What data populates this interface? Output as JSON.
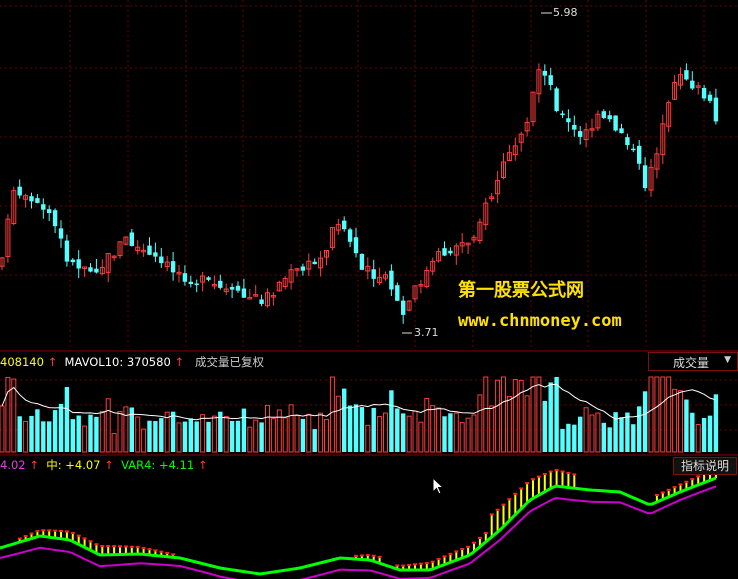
{
  "colors": {
    "up": "#ff3c3c",
    "down": "#54ffff",
    "grid": "#6a0000",
    "divider": "#8a0000",
    "mid": "#ffff00",
    "var4": "#00ff00",
    "upper": "#ff2020",
    "lower": "#cc00cc",
    "ma": "#ffffff"
  },
  "chart_data": [
    {
      "type": "candlestick",
      "panel": "price",
      "high_label": "5.98",
      "low_label": "3.71",
      "grid": true
    },
    {
      "type": "bar",
      "panel": "volume",
      "header": {
        "value_tail": "408140",
        "ma_label": "MAVOL10:",
        "ma_value": "370580",
        "adjusted_text": "成交量已复权"
      },
      "ma_series": "MAVOL10"
    },
    {
      "type": "line",
      "panel": "indicator",
      "header": {
        "first_value": "4.02",
        "mid_label": "中:",
        "mid_value": "+4.07",
        "var4_label": "VAR4:",
        "var4_value": "+4.11"
      },
      "series_names": [
        "中",
        "VAR4"
      ]
    }
  ],
  "ui": {
    "volume_dropdown": "成交量",
    "indicator_button": "指标说明"
  },
  "watermark": {
    "line1": "第一股票公式网",
    "line2": "www.chnmoney.com"
  },
  "icons": {
    "pointer": "mouse-pointer-icon",
    "selector": "chevron-down-icon"
  }
}
